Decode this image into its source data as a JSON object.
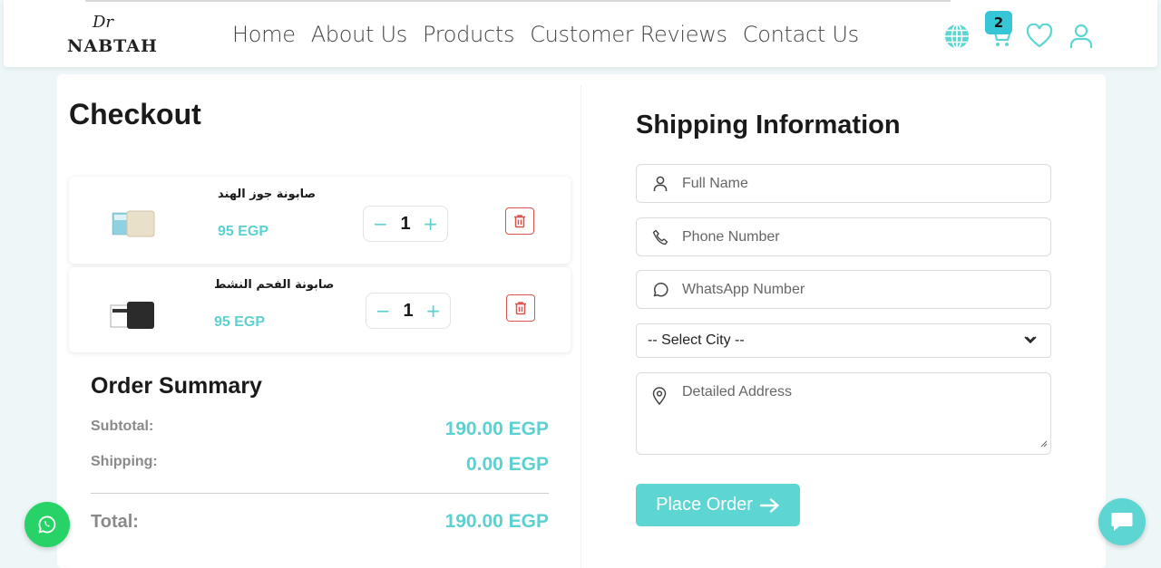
{
  "brand": {
    "logo_top": "Dr",
    "logo_name": "NABTAH"
  },
  "nav": {
    "items": [
      "Home",
      "About Us",
      "Products",
      "Customer Reviews",
      "Contact Us"
    ]
  },
  "header_icons": {
    "language": "globe-icon",
    "cart": "cart-icon",
    "wishlist": "heart-icon",
    "account": "user-icon",
    "cart_count": "2"
  },
  "checkout": {
    "title": "Checkout",
    "items": [
      {
        "name": "صابونة جوز الهند",
        "price": "95 EGP",
        "quantity": "1"
      },
      {
        "name": "صابونة الفحم النشط",
        "price": "95 EGP",
        "quantity": "1"
      }
    ],
    "quantity_minus": "−",
    "quantity_plus": "+"
  },
  "summary": {
    "title": "Order Summary",
    "subtotal_label": "Subtotal:",
    "subtotal_value": "190.00 EGP",
    "shipping_label": "Shipping:",
    "shipping_value": "0.00 EGP",
    "total_label": "Total:",
    "total_value": "190.00 EGP"
  },
  "shipping": {
    "title": "Shipping Information",
    "full_name_placeholder": "Full Name",
    "phone_placeholder": "Phone Number",
    "whatsapp_placeholder": "WhatsApp Number",
    "city_select": "-- Select City --",
    "address_placeholder": "Detailed Address",
    "place_order": "Place Order"
  },
  "colors": {
    "accent": "#5dd5d3",
    "badge": "#36c6d6",
    "danger": "#d9534f",
    "whatsapp": "#27d366"
  }
}
